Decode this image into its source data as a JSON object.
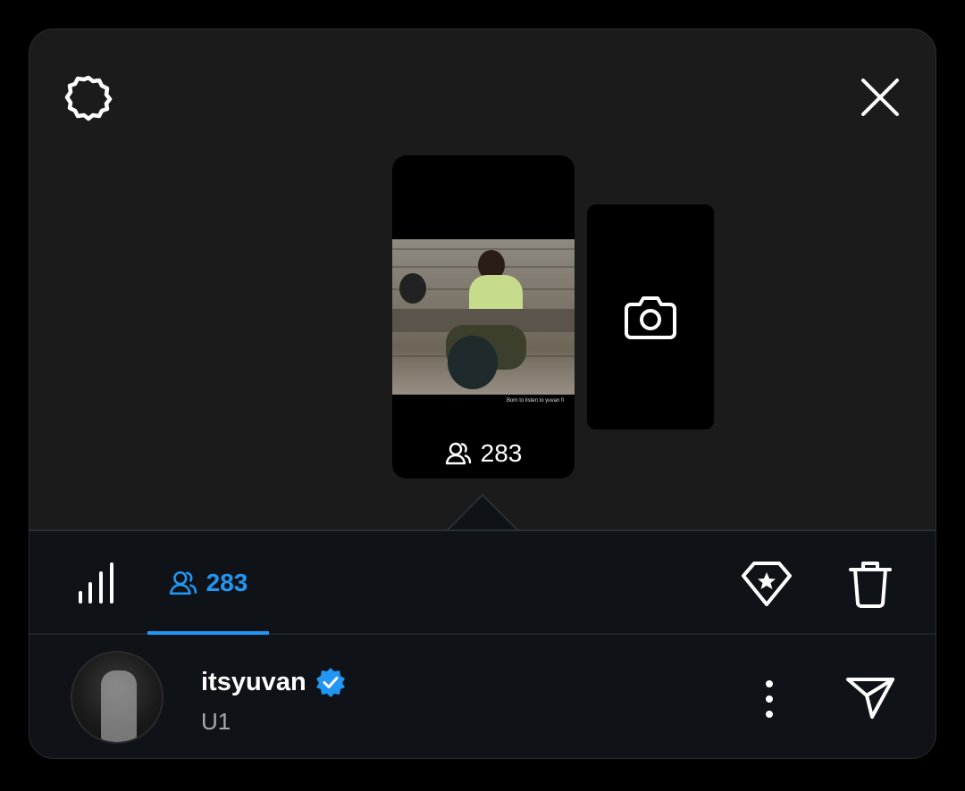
{
  "story": {
    "caption": "Born to listen to yuvan fi",
    "viewer_count": "283"
  },
  "tabs": {
    "viewers_count": "283"
  },
  "viewer": {
    "username": "itsyuvan",
    "subtitle": "U1",
    "verified": true
  },
  "icons": {
    "settings": "gear-icon",
    "close": "close-icon",
    "viewers": "viewers-icon",
    "camera": "camera-icon",
    "insights": "bar-chart-icon",
    "highlight": "highlight-icon",
    "delete": "trash-icon",
    "more": "more-vertical-icon",
    "send": "send-icon",
    "verified": "verified-badge-icon"
  },
  "colors": {
    "accent": "#2196f3",
    "background": "#1b1b1b",
    "bottom_sheet": "#0f1318"
  }
}
